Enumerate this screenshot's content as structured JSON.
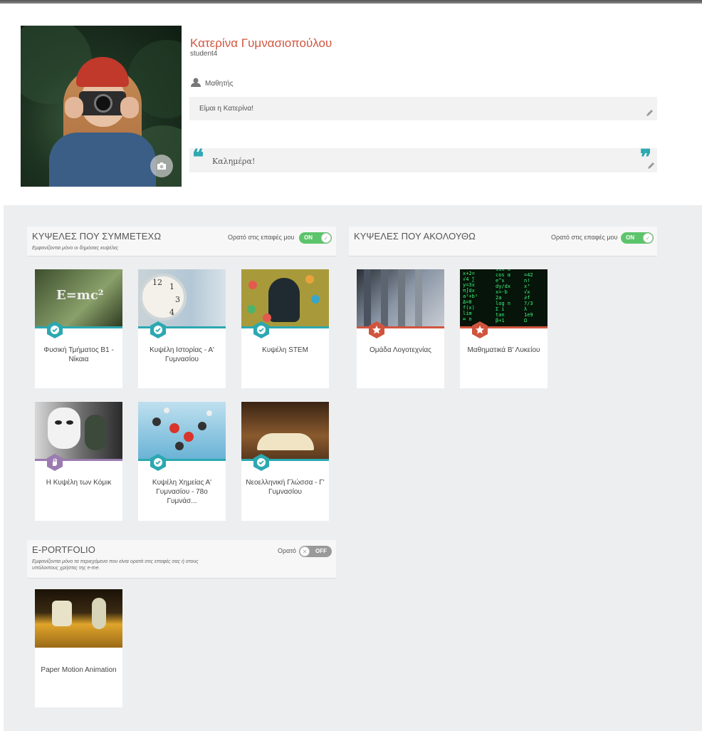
{
  "profile": {
    "name": "Κατερίνα Γυμνασιοπούλου",
    "username": "student4",
    "role": "Μαθητής",
    "bio": "Είμαι η Κατερίνα!",
    "quote": "Καλημέρα!",
    "quote_open_glyph": "❝",
    "quote_close_glyph": "❞"
  },
  "participating": {
    "title": "ΚΥΨΕΛΕΣ ΠΟΥ ΣΥΜΜΕΤΕΧΩ",
    "subtitle": "Εμφανίζονται μόνο οι δημόσιες κυψέλες",
    "visibility_label": "Ορατό στις επαφές μου",
    "toggle": "ON",
    "cards": [
      {
        "title": "Φυσική Τμήματος Β1 - Νίκαια",
        "badge": "check-icon",
        "color": "#2ca8b0"
      },
      {
        "title": "Κυψέλη Ιστορίας - Α' Γυμνασίου",
        "badge": "check-icon",
        "color": "#2ca8b0"
      },
      {
        "title": "Κυψέλη STEM",
        "badge": "check-icon",
        "color": "#2ca8b0"
      },
      {
        "title": "Η Κυψέλη των Κόμικ",
        "badge": "hand-icon",
        "color": "#9b7bb0"
      },
      {
        "title": "Κυψέλη Χημείας Α' Γυμνασίου - 78ο Γυμνάσ...",
        "badge": "check-icon",
        "color": "#2ca8b0"
      },
      {
        "title": "Νεοελληνική Γλώσσα - Γ' Γυμνασίου",
        "badge": "check-icon",
        "color": "#2ca8b0"
      }
    ]
  },
  "following": {
    "title": "ΚΥΨΕΛΕΣ ΠΟΥ ΑΚΟΛΟΥΘΩ",
    "visibility_label": "Ορατό στις επαφές μου",
    "toggle": "ON",
    "cards": [
      {
        "title": "Ομάδα Λογοτεχνίας",
        "badge": "star-icon",
        "color": "#d0553f"
      },
      {
        "title": "Μαθηματικά Β' Λυκείου",
        "badge": "star-icon",
        "color": "#d0553f"
      }
    ]
  },
  "portfolio": {
    "title": "E-PORTFOLIO",
    "subtitle_line1": "Εμφανίζονται μόνο τα περιεχόμενα που είναι ορατά στις επαφές σας ή στους",
    "subtitle_line2": "υπόλοιπους χρήστες της e-me.",
    "visibility_label": "Ορατό",
    "toggle": "OFF",
    "cards": [
      {
        "title": "Paper Motion Animation"
      }
    ]
  },
  "colors": {
    "accent_red": "#d0553f",
    "teal": "#2ca8b0",
    "purple": "#9b7bb0",
    "toggle_on": "#5cc46a",
    "toggle_off": "#9a9a9a",
    "grey_bg": "#edeef0"
  }
}
